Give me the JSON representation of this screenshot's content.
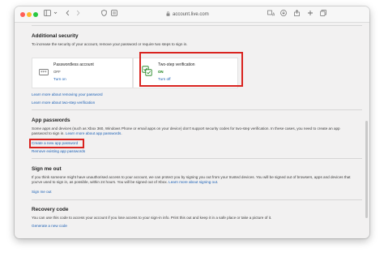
{
  "browser": {
    "url": "account.live.com",
    "traffic_lights": {
      "close": "#ff5f57",
      "minimize": "#febc2e",
      "zoom": "#28c840"
    },
    "icons": [
      "sidebar-icon",
      "back-icon",
      "forward-icon",
      "shield-icon",
      "reader-icon",
      "lock-icon",
      "translate-icon",
      "download-icon",
      "share-icon",
      "new-tab-icon",
      "tabs-icon"
    ]
  },
  "additional_security": {
    "heading": "Additional security",
    "description": "To increase the security of your account, remove your password or require two steps to sign in.",
    "passwordless": {
      "title": "Passwordless account",
      "status": "OFF",
      "action": "Turn on"
    },
    "two_step": {
      "title": "Two-step verification",
      "status": "ON",
      "action": "Turn off",
      "status_color": "#107c10"
    },
    "link_remove_password": "Learn more about removing your password",
    "link_two_step": "Learn more about two-step verification"
  },
  "app_passwords": {
    "heading": "App passwords",
    "description_line1": "Some apps and devices (such as Xbox 360, Windows Phone or email apps on your device) don't support security codes for two-step verification. In these cases, you need to create an",
    "description_line2_prefix": "app password to sign in. ",
    "description_link": "Learn more about app passwords",
    "description_suffix": ".",
    "create_link": "Create a new app password",
    "remove_link": "Remove existing app passwords"
  },
  "sign_me_out": {
    "heading": "Sign me out",
    "description_line1": "If you think someone might have unauthorised access to your account, we can protect you by signing you out from your trusted devices. You will be signed out of browsers, apps and",
    "description_line2_prefix": "devices that you've used to sign in, as possible, within 24 hours. You will be signed out of Xbox. ",
    "description_link": "Learn more about signing out",
    "description_suffix": ".",
    "action": "Sign me out"
  },
  "recovery_code": {
    "heading": "Recovery code",
    "description": "You can use this code to access your account if you lose access to your sign-in info. Print this out and keep it in a safe place or take a picture of it.",
    "action": "Generate a new code"
  },
  "highlight_color": "#d9231f"
}
